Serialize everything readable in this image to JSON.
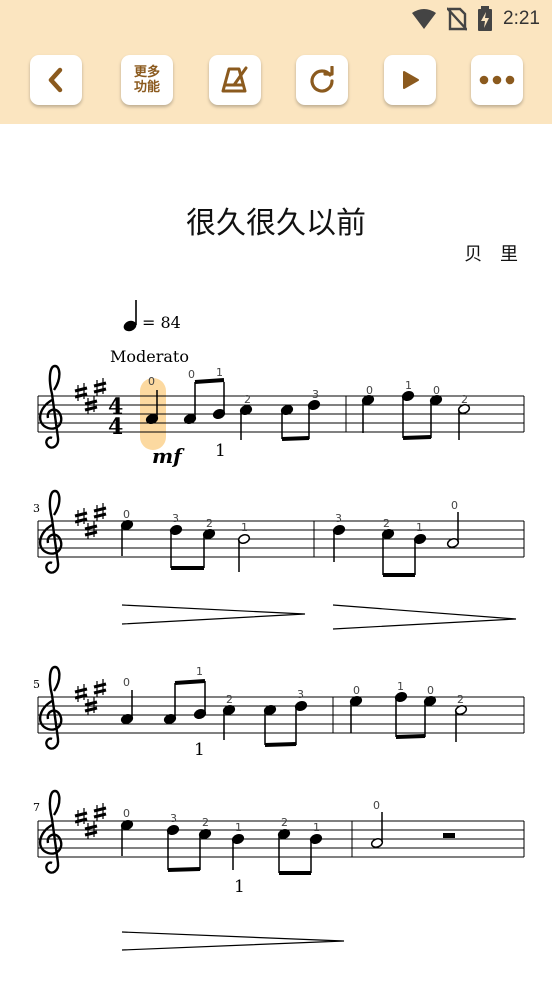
{
  "status_bar": {
    "time": "2:21",
    "icons": [
      "wifi-icon",
      "no-sim-icon",
      "battery-charging-icon"
    ]
  },
  "toolbar": {
    "back_icon": "chevron-left-icon",
    "more_functions_line1": "更多",
    "more_functions_line2": "功能",
    "metronome_icon": "metronome-icon",
    "replay_icon": "refresh-icon",
    "play_icon": "play-icon",
    "overflow_icon": "more-dots-icon",
    "accent_color": "#8b5a1e",
    "bar_color": "#fbe5c0"
  },
  "score": {
    "title": "很久很久以前",
    "composer": "贝 里",
    "tempo_value": "= 84",
    "tempo_text": "Moderato",
    "time_signature_top": "4",
    "time_signature_bottom": "4",
    "dynamic": "mf",
    "measure_numbers": [
      "3",
      "5",
      "7"
    ],
    "highlight_color": "#fcd9a0",
    "systems": [
      {
        "fingerings": [
          "0",
          "0",
          "1",
          "2",
          "3",
          "0",
          "1",
          "0",
          "2"
        ],
        "string_marks": [
          "1"
        ]
      },
      {
        "fingerings": [
          "0",
          "3",
          "2",
          "1",
          "3",
          "2",
          "1",
          "0"
        ]
      },
      {
        "fingerings": [
          "0",
          "1",
          "2",
          "3",
          "0",
          "1",
          "0",
          "2"
        ],
        "string_marks": [
          "1"
        ]
      },
      {
        "fingerings": [
          "0",
          "3",
          "2",
          "1",
          "2",
          "1",
          "0"
        ],
        "string_marks": [
          "1"
        ]
      }
    ]
  }
}
